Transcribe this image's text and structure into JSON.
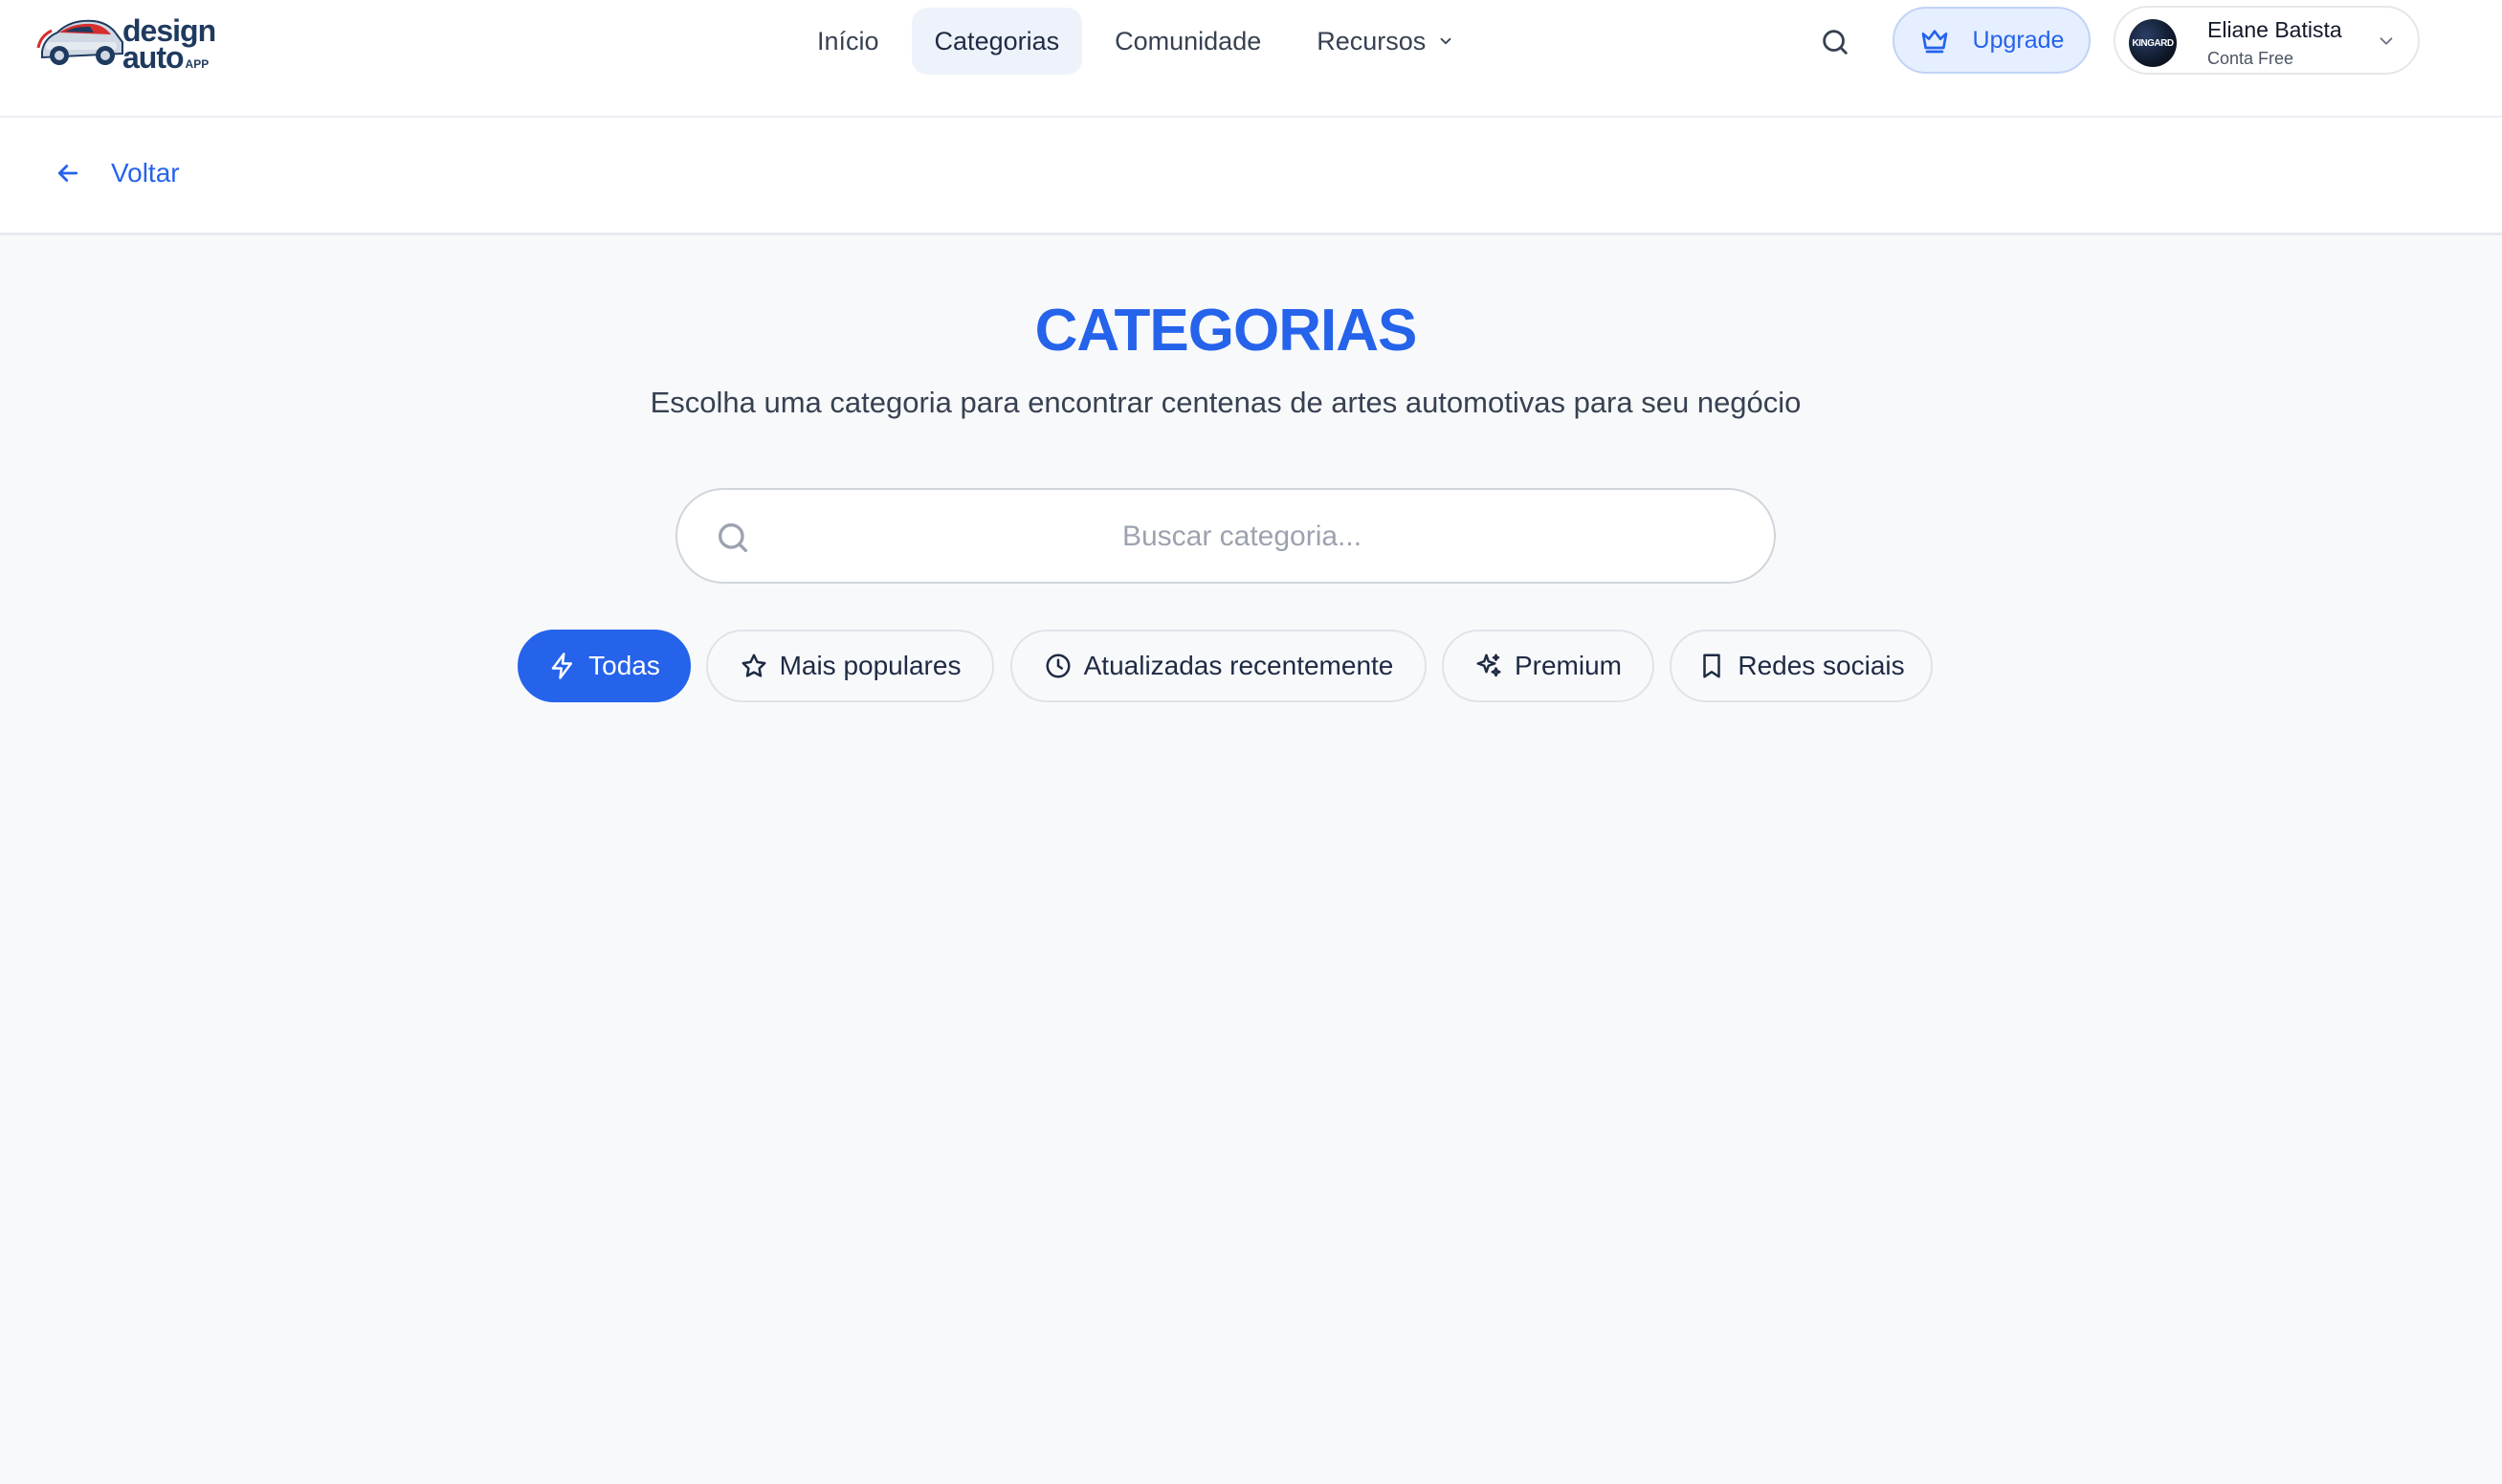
{
  "brand": {
    "line1": "design",
    "line2": "auto",
    "suffix": "APP"
  },
  "nav": {
    "items": [
      {
        "label": "Início"
      },
      {
        "label": "Categorias",
        "active": true
      },
      {
        "label": "Comunidade"
      },
      {
        "label": "Recursos",
        "has_dropdown": true
      }
    ]
  },
  "header": {
    "search_icon": "search-icon",
    "upgrade_label": "Upgrade",
    "upgrade_icon": "crown-icon"
  },
  "user": {
    "name": "Eliane Batista",
    "plan": "Conta Free",
    "avatar_text": "KINGARD"
  },
  "subbar": {
    "back_label": "Voltar",
    "back_icon": "arrow-left-icon"
  },
  "page": {
    "title": "CATEGORIAS",
    "subtitle": "Escolha uma categoria para encontrar centenas de artes automotivas para seu negócio"
  },
  "search": {
    "placeholder": "Buscar categoria...",
    "value": ""
  },
  "filters": [
    {
      "label": "Todas",
      "icon": "lightning-icon",
      "active": true
    },
    {
      "label": "Mais populares",
      "icon": "star-icon",
      "active": false
    },
    {
      "label": "Atualizadas recentemente",
      "icon": "clock-icon",
      "active": false
    },
    {
      "label": "Premium",
      "icon": "sparkles-icon",
      "active": false
    },
    {
      "label": "Redes sociais",
      "icon": "bookmark-icon",
      "active": false
    }
  ],
  "colors": {
    "accent": "#2563eb",
    "background": "#f8f9fb",
    "brand_dark": "#1e3a5f",
    "brand_red": "#d32f2f"
  }
}
